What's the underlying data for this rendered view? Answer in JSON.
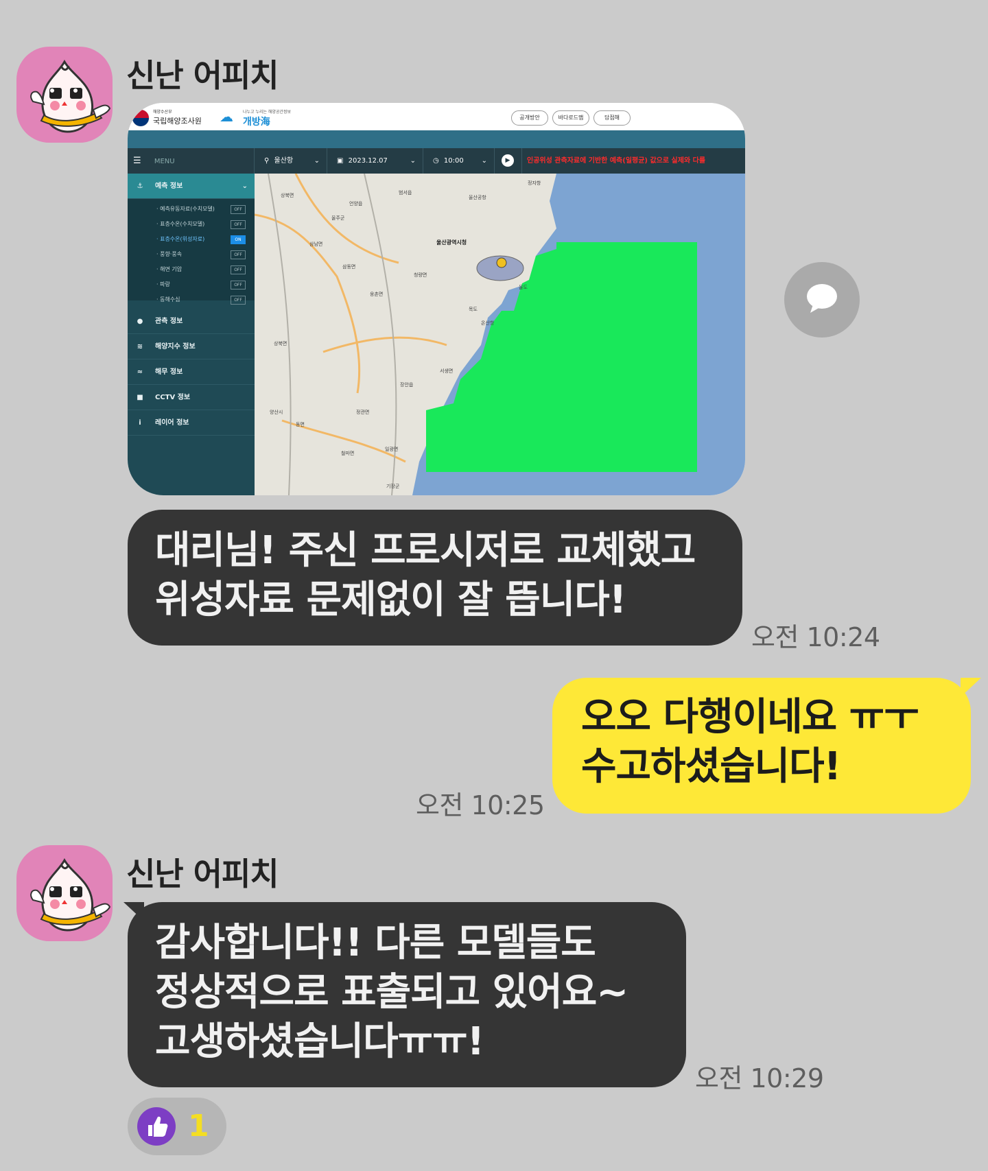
{
  "messages": [
    {
      "sender": "신난 어피치",
      "screenshot": {
        "header": {
          "ministry": "해양수산부",
          "institute": "국립해양조사원",
          "slogan": "나누고 누리는 해양공간정보",
          "brand": "개방海",
          "buttons": [
            "공개방안",
            "바다로드맵",
            "담점해"
          ]
        },
        "toolbar": {
          "menu": "MENU",
          "location": "울산항",
          "date": "2023.12.07",
          "time": "10:00",
          "notice": "인공위성 관측자료에 기반한 예측(일평균) 값으로 실제와 다를"
        },
        "sidebar": {
          "sections": [
            "예측 정보",
            "관측 정보",
            "해양지수 정보",
            "해무 정보",
            "CCTV 정보",
            "레이어 정보"
          ],
          "sub_items": [
            {
              "label": "· 예측유동자료(수치모델)",
              "state": "OFF"
            },
            {
              "label": "· 표층수온(수치모델)",
              "state": "OFF"
            },
            {
              "label": "· 표층수온(위성자료)",
              "state": "ON"
            },
            {
              "label": "· 풍향·풍속",
              "state": "OFF"
            },
            {
              "label": "· 해면 기압",
              "state": "OFF"
            },
            {
              "label": "· 파랑",
              "state": "OFF"
            },
            {
              "label": "· 동해수심",
              "state": "OFF"
            }
          ]
        },
        "map_labels": [
          "울산광역시청",
          "울산공항",
          "정자항",
          "울주군",
          "온산항",
          "양산시",
          "기장군",
          "서생면",
          "상북면",
          "언양읍",
          "범서읍",
          "청량면",
          "웅촌면",
          "장안읍",
          "정관면",
          "일광면",
          "철마면",
          "동면",
          "상북면",
          "삼동면",
          "삼남면",
          "울도",
          "목도"
        ],
        "colors": {
          "overlay": "#19e85a",
          "sea": "#7da4d2",
          "land": "#e6e4dc"
        }
      },
      "text": [
        "대리님! 주신 프로시저로 교체했고",
        "위성자료 문제없이 잘 뜹니다!"
      ],
      "time": "오전 10:24"
    },
    {
      "sender": "me",
      "text": [
        "오오 다행이네요 ㅠㅜ",
        "수고하셨습니다!"
      ],
      "time": "오전 10:25"
    },
    {
      "sender": "신난 어피치",
      "text": [
        "감사합니다!! 다른 모델들도",
        "정상적으로 표출되고 있어요~",
        "고생하셨습니다ㅠㅠ!"
      ],
      "time": "오전 10:29",
      "reaction": {
        "icon": "thumbs-up-icon",
        "count": "1"
      }
    }
  ],
  "colors": {
    "background": "#cbcbcb",
    "incoming": "#353535",
    "outgoing": "#fee837",
    "avatar": "#e184b8",
    "reaction_count": "#f4de22"
  }
}
